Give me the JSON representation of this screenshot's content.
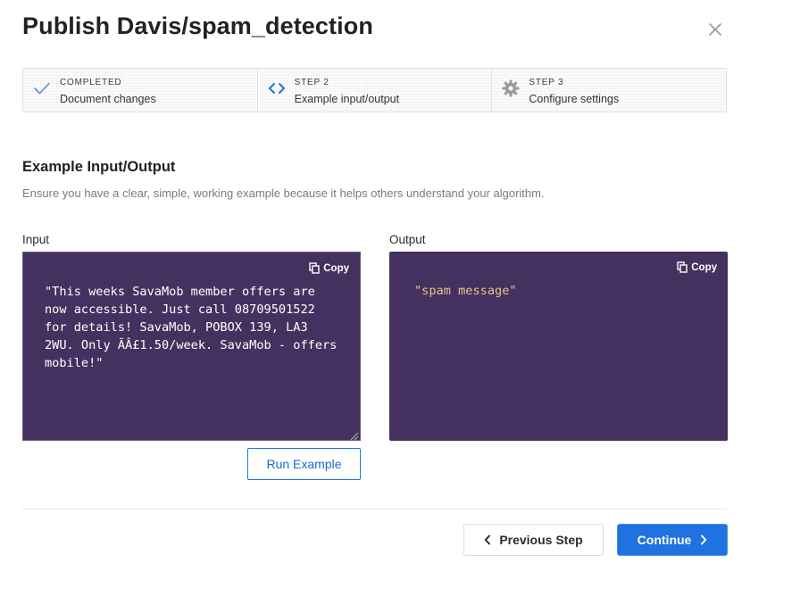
{
  "dialog": {
    "title": "Publish Davis/spam_detection",
    "close_icon": "close-icon"
  },
  "steps": [
    {
      "kicker": "COMPLETED",
      "label": "Document changes",
      "icon": "checkmark-icon",
      "state": "completed"
    },
    {
      "kicker": "STEP 2",
      "label": "Example input/output",
      "icon": "code-brackets-icon",
      "state": "active"
    },
    {
      "kicker": "STEP 3",
      "label": "Configure settings",
      "icon": "gear-icon",
      "state": "upcoming"
    }
  ],
  "section": {
    "title": "Example Input/Output",
    "description": "Ensure you have a clear, simple, working example because it helps others understand your algorithm."
  },
  "input": {
    "label": "Input",
    "copy_label": "Copy",
    "value": "\"This weeks SavaMob member offers are now accessible. Just call 08709501522 for details! SavaMob, POBOX 139, LA3 2WU. Only ÃÂ£1.50/week. SavaMob - offers mobile!\""
  },
  "output": {
    "label": "Output",
    "copy_label": "Copy",
    "value": "\"spam message\""
  },
  "actions": {
    "run_example": "Run Example",
    "previous_step": "Previous Step",
    "continue": "Continue"
  },
  "colors": {
    "accent": "#1f72e0",
    "editor_bg": "#45315f",
    "output_string": "#e8c38c"
  }
}
